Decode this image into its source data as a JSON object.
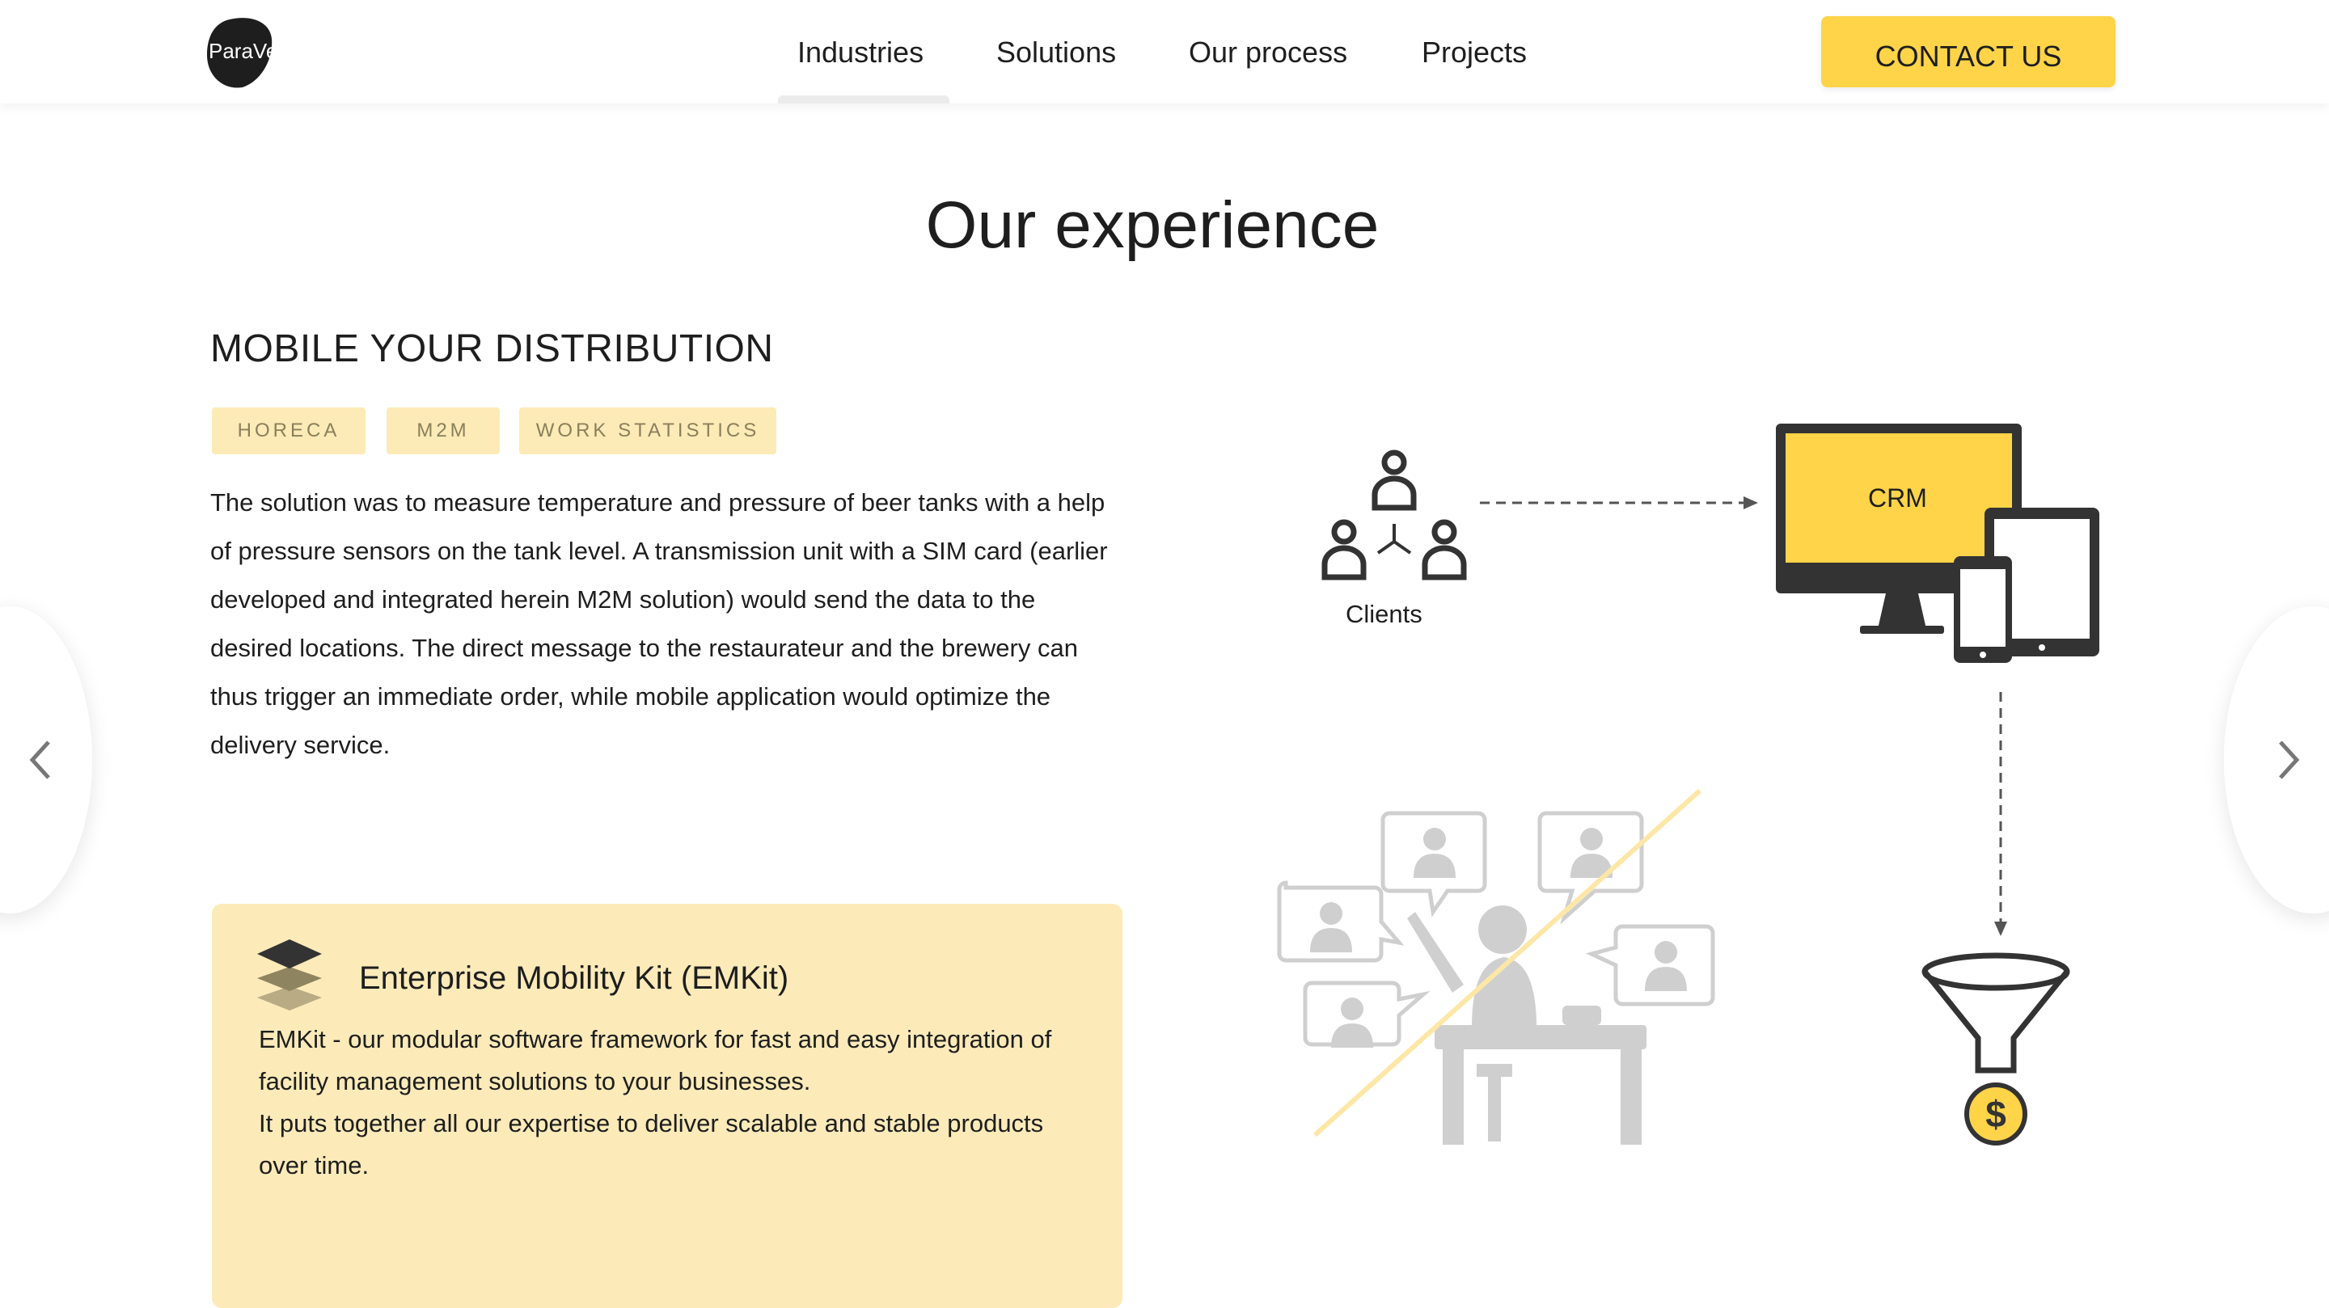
{
  "header": {
    "logo_text": "ParaVect",
    "nav": [
      "Industries",
      "Solutions",
      "Our process",
      "Projects"
    ],
    "active_nav": "Industries",
    "contact_label": "CONTACT US"
  },
  "main": {
    "title": "Our experience",
    "project": {
      "title": "MOBILE YOUR DISTRIBUTION",
      "tags": [
        "HORECA",
        "M2M",
        "WORK STATISTICS"
      ],
      "description": "The solution was to measure temperature and pressure of beer tanks with a help of pressure sensors on the tank level. A transmission unit with a SIM card (earlier developed and integrated herein M2M solution) would send the data to the desired locations. The direct message to the restaurateur and the brewery can thus trigger an immediate order, while mobile application would optimize the delivery service."
    },
    "emkit": {
      "title": "Enterprise Mobility Kit (EMKit)",
      "line1": "EMKit - our modular software framework for fast and easy integration of facility management solutions to your businesses.",
      "line2": "It puts together all our expertise to deliver scalable and stable products over time."
    },
    "diagram": {
      "clients_label": "Clients",
      "crm_label": "CRM"
    }
  },
  "colors": {
    "accent": "#ffd449",
    "tag_bg": "#fcebb6",
    "card_bg": "#fcebb9",
    "icon_dark": "#333333",
    "icon_grey": "#cfcfcf"
  },
  "icons": [
    "logo-icon",
    "clients-icon",
    "crm-monitor-icon",
    "tablet-icon",
    "phone-icon",
    "funnel-icon",
    "dollar-coin-icon",
    "call-center-illustration",
    "layers-icon",
    "chevron-left-icon",
    "chevron-right-icon"
  ]
}
